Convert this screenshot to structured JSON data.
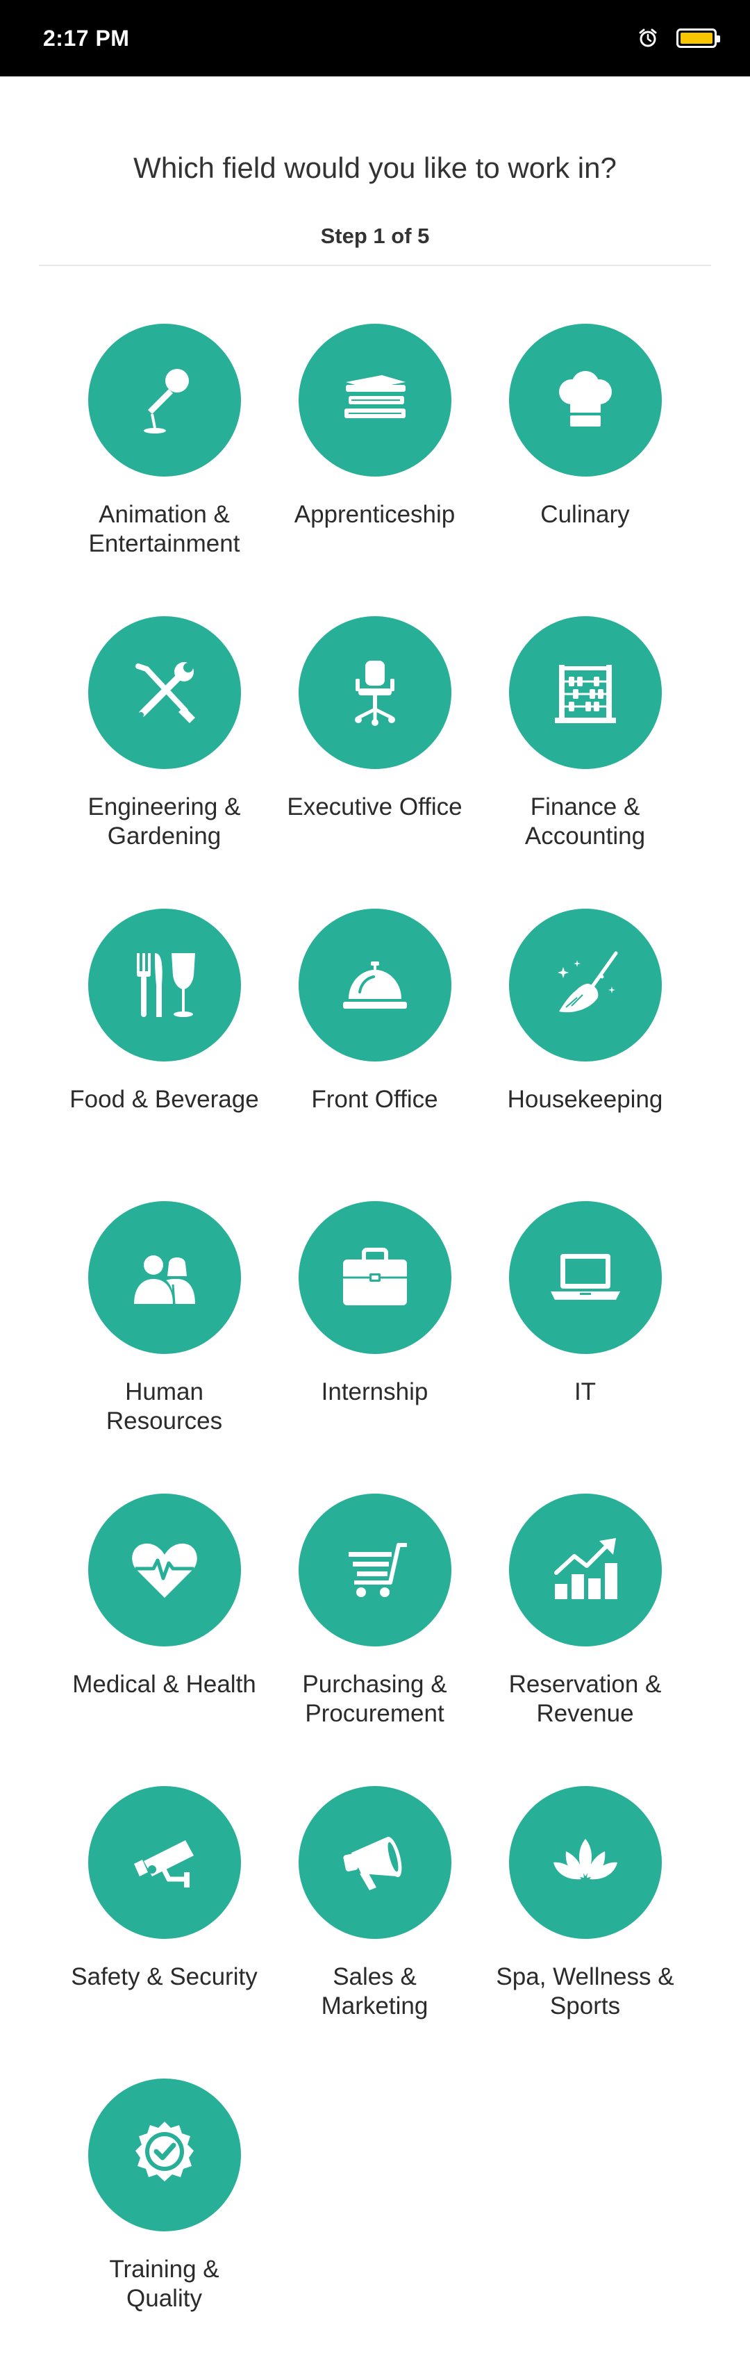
{
  "status_bar": {
    "time": "2:17 PM",
    "icons": [
      "alarm-icon",
      "battery-icon"
    ],
    "battery_color": "#f7c600"
  },
  "header": {
    "title": "Which field would you like to work in?",
    "step": "Step 1 of 5"
  },
  "theme": {
    "accent": "#27b097"
  },
  "fields": [
    {
      "label": "Animation &\nEntertainment",
      "icon": "microphone-icon"
    },
    {
      "label": "Apprenticeship",
      "icon": "books-icon"
    },
    {
      "label": "Culinary",
      "icon": "chef-hat-icon"
    },
    {
      "label": "Engineering &\nGardening",
      "icon": "tools-icon"
    },
    {
      "label": "Executive Office",
      "icon": "office-chair-icon"
    },
    {
      "label": "Finance &\nAccounting",
      "icon": "abacus-icon"
    },
    {
      "label": "Food & Beverage",
      "icon": "cutlery-glass-icon"
    },
    {
      "label": "Front Office",
      "icon": "service-bell-icon"
    },
    {
      "label": "Housekeeping",
      "icon": "broom-icon"
    },
    {
      "label": "Human\nResources",
      "icon": "people-icon"
    },
    {
      "label": "Internship",
      "icon": "briefcase-icon"
    },
    {
      "label": "IT",
      "icon": "laptop-icon"
    },
    {
      "label": "Medical & Health",
      "icon": "heartbeat-icon"
    },
    {
      "label": "Purchasing &\nProcurement",
      "icon": "shopping-cart-icon"
    },
    {
      "label": "Reservation &\nRevenue",
      "icon": "growth-chart-icon"
    },
    {
      "label": "Safety & Security",
      "icon": "security-camera-icon"
    },
    {
      "label": "Sales &\nMarketing",
      "icon": "megaphone-icon"
    },
    {
      "label": "Spa, Wellness &\nSports",
      "icon": "lotus-icon"
    },
    {
      "label": "Training &\nQuality",
      "icon": "quality-badge-icon"
    }
  ]
}
